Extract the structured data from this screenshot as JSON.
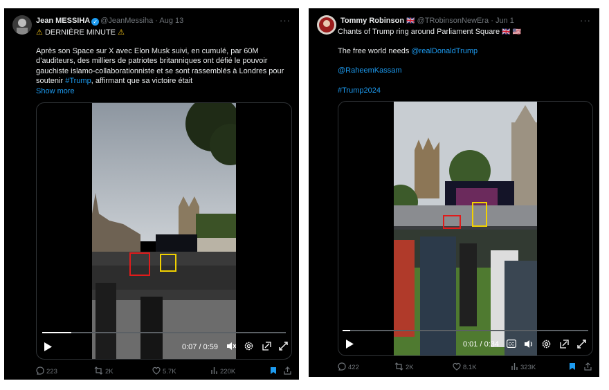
{
  "tweets": [
    {
      "author": "Jean MESSIHA",
      "handle": "@JeanMessiha",
      "date": "Aug 13",
      "headline": "DERNIÈRE MINUTE",
      "body_lines": [
        "Après son Space sur X avec Elon Musk suivi, en cumulé, par 60M",
        "d’auditeurs, des milliers de patriotes britanniques ont défié le pouvoir",
        "gauchiste islamo-collaborationniste et se sont rassemblés à Londres pour"
      ],
      "body_last_pre": "soutenir ",
      "body_last_link": "#Trump",
      "body_last_post": ", affirmant que sa victoire était",
      "show_more": "Show more",
      "video": {
        "time": "0:07 / 0:59",
        "progress": 0.12
      },
      "stats": {
        "replies": "223",
        "reposts": "2K",
        "likes": "5.7K",
        "views": "220K"
      }
    },
    {
      "author": "Tommy Robinson",
      "author_flag": "🇬🇧",
      "handle": "@TRobinsonNewEra",
      "date": "Jun 1",
      "line1": "Chants of Trump ring around Parliament Square",
      "line1_flags": "🇬🇧 🇺🇸",
      "line2_pre": "The free world needs ",
      "line2_link": "@realDonaldTrump",
      "line3_link": "@RaheemKassam",
      "line4_link": "#Trump2024",
      "video": {
        "time": "0:01 / 0:34",
        "progress": 0.03
      },
      "stats": {
        "replies": "422",
        "reposts": "2K",
        "likes": "8.1K",
        "views": "323K"
      }
    }
  ]
}
